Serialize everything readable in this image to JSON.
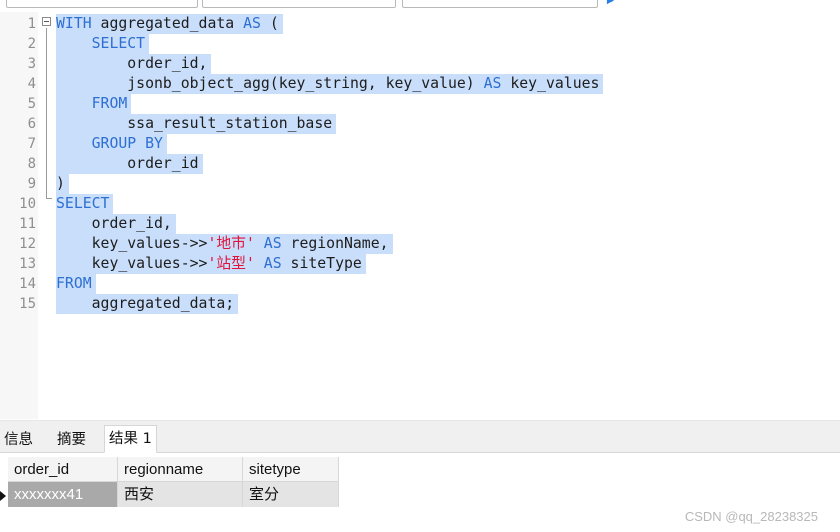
{
  "editor": {
    "lines": [
      {
        "n": "1",
        "segs": [
          {
            "t": "WITH",
            "c": "kw"
          },
          {
            "t": " aggregated_data "
          },
          {
            "t": "AS",
            "c": "kw"
          },
          {
            "t": " ("
          }
        ]
      },
      {
        "n": "2",
        "segs": [
          {
            "t": "    "
          },
          {
            "t": "SELECT",
            "c": "kw"
          }
        ]
      },
      {
        "n": "3",
        "segs": [
          {
            "t": "        order_id,"
          }
        ]
      },
      {
        "n": "4",
        "segs": [
          {
            "t": "        jsonb_object_agg(key_string, key_value) "
          },
          {
            "t": "AS",
            "c": "kw"
          },
          {
            "t": " key_values"
          }
        ]
      },
      {
        "n": "5",
        "segs": [
          {
            "t": "    "
          },
          {
            "t": "FROM",
            "c": "kw"
          }
        ]
      },
      {
        "n": "6",
        "segs": [
          {
            "t": "        ssa_result_station_base"
          }
        ]
      },
      {
        "n": "7",
        "segs": [
          {
            "t": "    "
          },
          {
            "t": "GROUP BY",
            "c": "kw"
          }
        ]
      },
      {
        "n": "8",
        "segs": [
          {
            "t": "        order_id"
          }
        ]
      },
      {
        "n": "9",
        "segs": [
          {
            "t": ")"
          }
        ]
      },
      {
        "n": "10",
        "segs": [
          {
            "t": "SELECT",
            "c": "kw"
          }
        ]
      },
      {
        "n": "11",
        "segs": [
          {
            "t": "    order_id,"
          }
        ]
      },
      {
        "n": "12",
        "segs": [
          {
            "t": "    key_values->>"
          },
          {
            "t": "'地市'",
            "c": "str"
          },
          {
            "t": " "
          },
          {
            "t": "AS",
            "c": "kw"
          },
          {
            "t": " regionName,"
          }
        ]
      },
      {
        "n": "13",
        "segs": [
          {
            "t": "    key_values->>"
          },
          {
            "t": "'站型'",
            "c": "str"
          },
          {
            "t": " "
          },
          {
            "t": "AS",
            "c": "kw"
          },
          {
            "t": " siteType"
          }
        ]
      },
      {
        "n": "14",
        "segs": [
          {
            "t": "FROM",
            "c": "kw"
          }
        ]
      },
      {
        "n": "15",
        "segs": [
          {
            "t": "    aggregated_data;"
          }
        ]
      }
    ]
  },
  "result_tabs": {
    "info": "信息",
    "summary": "摘要",
    "result1": "结果 1"
  },
  "result_grid": {
    "columns": [
      "order_id",
      "regionname",
      "sitetype"
    ],
    "rows": [
      [
        "xxxxxxx41",
        "西安",
        "室分"
      ]
    ]
  },
  "watermark": "CSDN @qq_28238325",
  "colors": {
    "selection": "#c9defa",
    "keyword": "#2d6fd2",
    "string": "#e0133a"
  }
}
